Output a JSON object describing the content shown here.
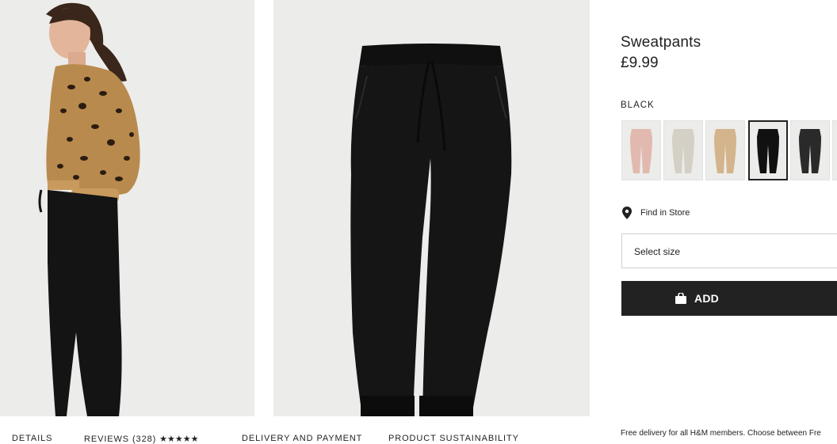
{
  "product": {
    "title": "Sweatpants",
    "price": "£9.99",
    "color_label": "BLACK"
  },
  "colors": {
    "accent": "#222222",
    "image_bg": "#ececea",
    "swatches": [
      "#e2b9ae",
      "#d4d0c6",
      "#d4b48c",
      "#111111",
      "#2a2a2a"
    ]
  },
  "swatches": [
    {
      "name": "light pink",
      "selected": false
    },
    {
      "name": "light beige",
      "selected": false
    },
    {
      "name": "beige",
      "selected": false
    },
    {
      "name": "black",
      "selected": true
    },
    {
      "name": "dark grey",
      "selected": false
    }
  ],
  "actions": {
    "find_in_store": "Find in Store",
    "select_size": "Select size",
    "add": "ADD"
  },
  "icons": {
    "store": "map-pin-icon",
    "bag": "shopping-bag-icon"
  },
  "tabs": {
    "details": "DETAILS",
    "reviews": "REVIEWS (328)",
    "reviews_stars": "★★★★★",
    "delivery": "DELIVERY AND PAYMENT",
    "sustainability": "PRODUCT SUSTAINABILITY"
  },
  "delivery_note": "Free delivery for all H&M members. Choose between Fre"
}
